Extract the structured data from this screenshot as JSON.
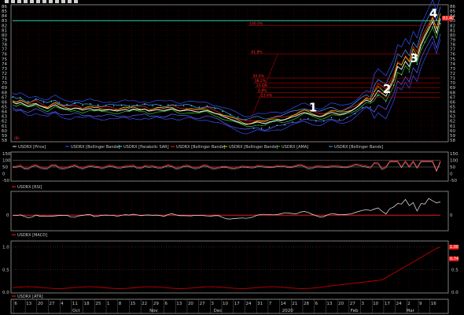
{
  "app": {
    "toolbar_icons": [
      "arrow-icon",
      "cross-icon",
      "zoom-in-icon",
      "zoom-out-icon",
      "line-icon",
      "text-icon",
      "fib-icon",
      "channel-icon",
      "pitchfork-icon",
      "gann-icon",
      "settings-icon",
      "print-icon"
    ]
  },
  "colors": {
    "bg": "#000000",
    "border": "#9a9a9a",
    "grid": "#8a0000",
    "price": "#e8e8e8",
    "sar": "#40ffff",
    "red": "#ff2020",
    "green": "#30d030",
    "yellow": "#e0e000",
    "blue": "#3050ff",
    "cyan_level": "#30d0b0"
  },
  "chart_data": [
    {
      "type": "line",
      "panel": "price",
      "ylim": [
        58,
        86
      ],
      "yticks": [
        58,
        59,
        60,
        61,
        62,
        63,
        64,
        65,
        66,
        67,
        68,
        69,
        70,
        71,
        72,
        73,
        74,
        75,
        76,
        77,
        78,
        79,
        80,
        81,
        82,
        83,
        84,
        85,
        86
      ],
      "x_index_range": [
        0,
        110
      ],
      "series": [
        {
          "name": "USDRX [Price]",
          "values": [
            66,
            65.6,
            65.9,
            65.5,
            65.1,
            65.3,
            65.6,
            65.2,
            64.9,
            64.6,
            65.1,
            65.4,
            64.9,
            64.6,
            64.5,
            64.4,
            64.7,
            64.6,
            64.3,
            64.5,
            64.6,
            64.3,
            64.4,
            64.2,
            64.3,
            64.4,
            64.2,
            64.1,
            64.3,
            64.4,
            64.2,
            64.5,
            64.4,
            64.3,
            64.5,
            64.1,
            64.2,
            64.4,
            64.3,
            64.2,
            64.4,
            64.6,
            64.3,
            64.1,
            64.2,
            64.3,
            64.2,
            64.0,
            63.9,
            64.1,
            64.2,
            63.9,
            63.6,
            63.4,
            63.0,
            62.7,
            62.4,
            62.1,
            61.8,
            61.5,
            61.3,
            61.4,
            61.6,
            61.8,
            61.6,
            61.5,
            61.8,
            62.0,
            62.2,
            62.1,
            62.3,
            62.6,
            62.9,
            63.1,
            63.5,
            63.8,
            63.6,
            63.3,
            63.1,
            62.9,
            63.1,
            63.5,
            63.8,
            63.6,
            63.4,
            63.5,
            63.8,
            64.1,
            64.6,
            65.2,
            65.9,
            66.4,
            66.0,
            67.1,
            68.4,
            67.8,
            67.2,
            68.9,
            70.6,
            73.4,
            72.8,
            74.5,
            73.4,
            76.2,
            75.0,
            77.8,
            79.6,
            81.2,
            82.8,
            80.4,
            83.5
          ]
        },
        {
          "name": "USDRX [Bollinger Bands]",
          "values": []
        },
        {
          "name": "USDRX [Parabolic SAR]",
          "values": []
        },
        {
          "name": "USDRX [Bollinger Bands]",
          "values": []
        },
        {
          "name": "USDRX [Bollinger Bands]",
          "values": []
        },
        {
          "name": "USDRX [AMA]",
          "values": []
        },
        {
          "name": "USDRX [Bollinger Bands]",
          "values": []
        }
      ],
      "horizontal_levels": [
        83
      ],
      "fib_levels": [
        82,
        76,
        71,
        70,
        69,
        68,
        67
      ],
      "fib_labels": [
        "100.0%",
        "61.8%",
        "50.0%",
        "38.2%",
        "23.6%",
        "0.0%",
        "-23.6%"
      ],
      "annotations": [
        {
          "text": "1",
          "x_index": 77,
          "y": 64.8
        },
        {
          "text": "2",
          "x_index": 96,
          "y": 68.7
        },
        {
          "text": "3",
          "x_index": 103,
          "y": 75.1
        },
        {
          "text": "4",
          "x_index": 108,
          "y": 84.5
        }
      ],
      "current_value_label": "83.40"
    },
    {
      "type": "line",
      "panel": "rsi",
      "ylim": [
        -50,
        150
      ],
      "yticks": [
        150,
        100,
        50,
        0,
        -50
      ],
      "series": [
        {
          "name": "USDRX [RSI]",
          "values": []
        }
      ]
    },
    {
      "type": "line",
      "panel": "macd",
      "ylim": [
        -4,
        6
      ],
      "yticks": [
        0
      ],
      "series": [
        {
          "name": "USDRX [MACD]",
          "values": []
        }
      ]
    },
    {
      "type": "line",
      "panel": "atr",
      "ylim": [
        0,
        1.1
      ],
      "yticks": [
        1.0,
        0.5,
        0.0
      ],
      "series": [
        {
          "name": "USDRX [ATR]",
          "values": []
        }
      ],
      "current_value_labels": [
        "1.00",
        "0.74"
      ]
    }
  ],
  "xaxis": {
    "dates": [
      "6",
      "13",
      "20",
      "27",
      "4",
      "11",
      "18",
      "25",
      "1",
      "8",
      "15",
      "22",
      "29",
      "6",
      "13",
      "20",
      "27",
      "3",
      "10",
      "17",
      "24",
      "31",
      "7",
      "14",
      "21",
      "28",
      "6",
      "13",
      "20",
      "27",
      "3",
      "10",
      "17",
      "24",
      "2",
      "9",
      "16"
    ],
    "months": [
      "Oct",
      "Nov",
      "Dec",
      "2020",
      "Feb",
      "Mar"
    ]
  },
  "legends": {
    "price": [
      "USDRX [Price]",
      "USDRX [Bollinger Bands]",
      "USDRX [Parabolic SAR]",
      "USDRX [Bollinger Bands]",
      "USDRX [Bollinger Bands]",
      "USDRX [AMA]",
      "USDRX [Bollinger Bands]"
    ],
    "rsi": "USDRX [RSI]",
    "macd": "USDRX [MACD]",
    "atr": "USDRX [ATR]"
  },
  "corner_label": "(B)"
}
